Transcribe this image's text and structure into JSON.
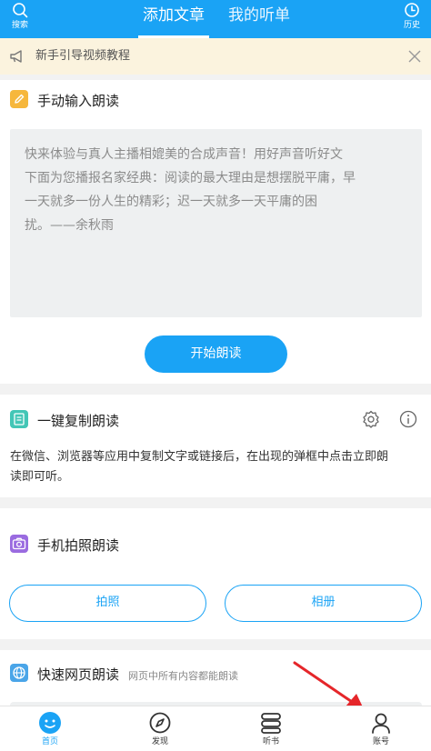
{
  "topbar": {
    "search_label": "搜索",
    "history_label": "历史",
    "tabs": [
      {
        "label": "添加文章",
        "active": true
      },
      {
        "label": "我的听单",
        "active": false
      }
    ],
    "bg_color": "#1aa3f5"
  },
  "notice": {
    "text": "新手引导视频教程",
    "bg_color": "#fbf3de"
  },
  "manual_card": {
    "title": "手动输入朗读",
    "placeholder_lines": [
      "快来体验与真人主播相媲美的合成声音！用好声音听好文",
      "下面为您播报名家经典：阅读的最大理由是想摆脱平庸，早",
      "一天就多一份人生的精彩；迟一天就多一天平庸的困",
      "扰。——余秋雨"
    ],
    "button_label": "开始朗读",
    "icon": "pencil-icon"
  },
  "copy_card": {
    "title": "一键复制朗读",
    "desc_lines": [
      "在微信、浏览器等应用中复制文字或链接后，在出现的弹框中点击立即朗",
      "读即可听。"
    ],
    "icon": "copy-icon"
  },
  "photo_card": {
    "title": "手机拍照朗读",
    "buttons": [
      "拍照",
      "相册"
    ],
    "icon": "camera-icon"
  },
  "web_card": {
    "title": "快速网页朗读",
    "subtitle": "网页中所有内容都能朗读",
    "icon": "globe-icon"
  },
  "bottom_nav": [
    {
      "label": "首页",
      "icon": "home-face-icon",
      "active": true
    },
    {
      "label": "发现",
      "icon": "compass-icon",
      "active": false
    },
    {
      "label": "听书",
      "icon": "book-stack-icon",
      "active": false
    },
    {
      "label": "账号",
      "icon": "user-icon",
      "active": false
    }
  ],
  "colors": {
    "accent": "#1aa3f5",
    "annotation_arrow": "#e5262a"
  }
}
